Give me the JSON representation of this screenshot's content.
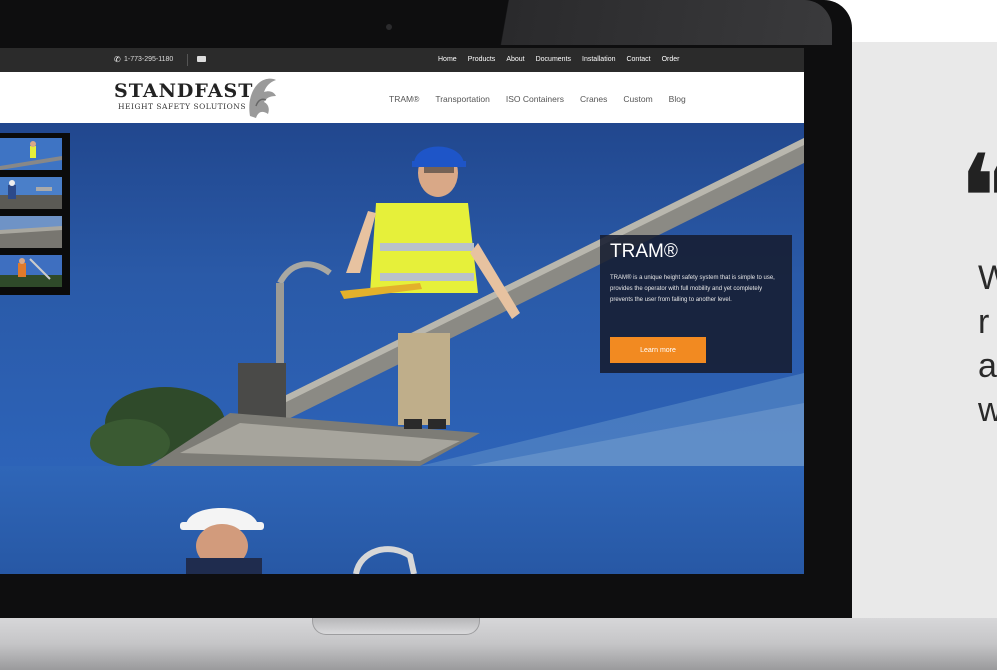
{
  "side": {
    "quote_mark": "❝",
    "letters": [
      "W",
      "r",
      "a",
      "w"
    ]
  },
  "topbar": {
    "phone_icon": "phone-icon",
    "phone": "1-773-295-1180",
    "mail_icon": "mail-icon",
    "nav": [
      "Home",
      "Products",
      "About",
      "Documents",
      "Installation",
      "Contact",
      "Order"
    ]
  },
  "header": {
    "logo_main": "STANDFAST",
    "logo_sub": "HEIGHT SAFETY SOLUTIONS",
    "nav": [
      "TRAM®",
      "Transportation",
      "ISO Containers",
      "Cranes",
      "Custom",
      "Blog"
    ]
  },
  "hero": {
    "title": "TRAM®",
    "body": "TRAM® is a unique height safety system that is simple to use, provides the operator with full mobility and yet completely prevents the user from falling to another level.",
    "button": "Learn more"
  },
  "colors": {
    "accent": "#f28a21",
    "topbar": "#2b2b2b",
    "sky": "#2a5aa8"
  }
}
